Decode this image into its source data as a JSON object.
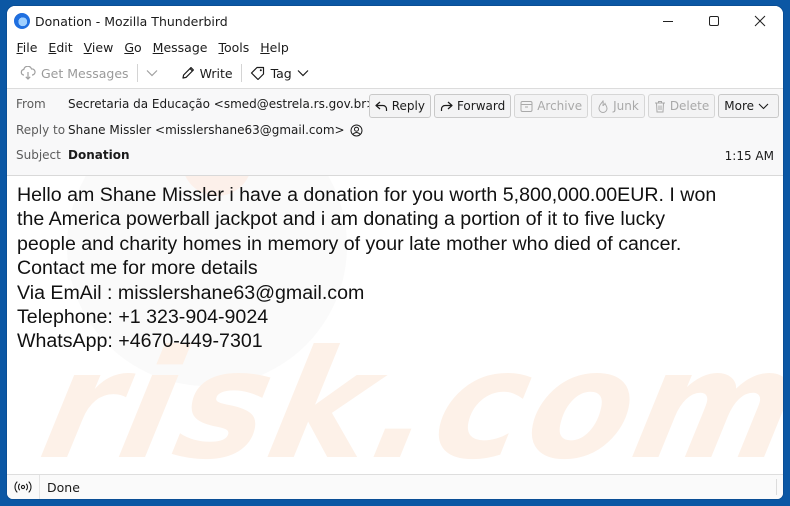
{
  "window": {
    "title": "Donation - Mozilla Thunderbird",
    "controls": {
      "minimize": "minimize-icon",
      "maximize": "maximize-icon",
      "close": "close-icon"
    }
  },
  "menubar": {
    "items": [
      {
        "accel": "F",
        "rest": "ile"
      },
      {
        "accel": "E",
        "rest": "dit"
      },
      {
        "accel": "V",
        "rest": "iew"
      },
      {
        "accel": "G",
        "rest": "o"
      },
      {
        "accel": "M",
        "rest": "essage"
      },
      {
        "accel": "T",
        "rest": "ools"
      },
      {
        "accel": "H",
        "rest": "elp"
      }
    ]
  },
  "toolbar": {
    "get_messages": "Get Messages",
    "write": "Write",
    "tag": "Tag"
  },
  "header": {
    "from_label": "From",
    "from_value": "Secretaria da Educação <smed@estrela.rs.gov.br>",
    "reply_to_label": "Reply to",
    "reply_to_value": "Shane Missler <misslershane63@gmail.com>",
    "subject_label": "Subject",
    "subject_value": "Donation",
    "time": "1:15 AM",
    "buttons": {
      "reply": "Reply",
      "forward": "Forward",
      "archive": "Archive",
      "junk": "Junk",
      "delete": "Delete",
      "more": "More"
    }
  },
  "message": {
    "lines": [
      "Hello am Shane Missler i have a donation for you worth 5,800,000.00EUR. I won",
      "the America powerball jackpot and i am donating a portion of it to five lucky",
      "people and charity homes in memory of your late mother who died of cancer.",
      "Contact me for more details",
      "Via EmAil : misslershane63@gmail.com",
      "Telephone: +1 323-904-9024",
      "WhatsApp: +4670-449-7301"
    ]
  },
  "watermark": "risk.com",
  "status": {
    "text": "Done"
  },
  "colors": {
    "frame": "#0b57a4",
    "header_bg": "#f8f8f9",
    "disabled_text": "#9a9a9a"
  }
}
